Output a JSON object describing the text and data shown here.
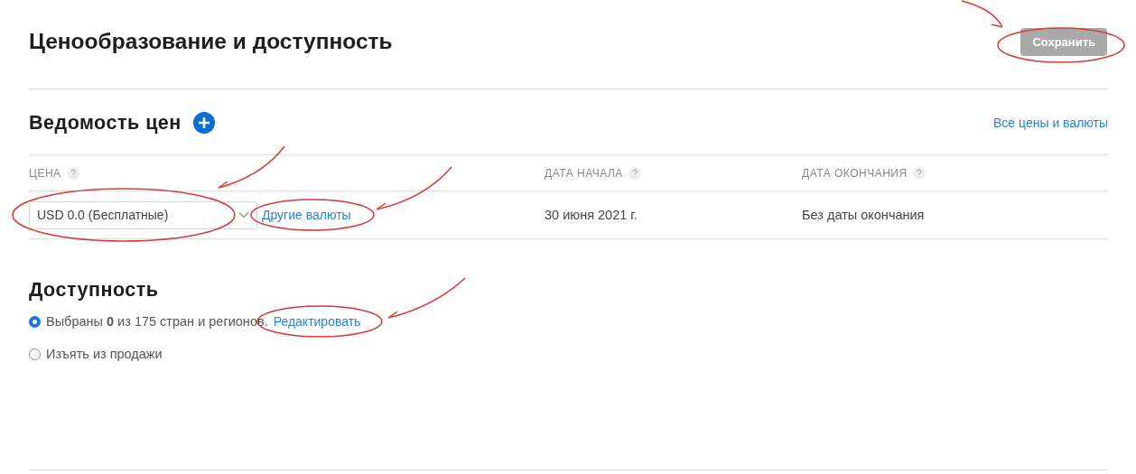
{
  "header": {
    "title": "Ценообразование и доступность",
    "save_button": {
      "label": "Сохранить",
      "disabled": true
    }
  },
  "price_schedule": {
    "title": "Ведомость цен",
    "all_prices_link": "Все цены и валюты",
    "columns": [
      {
        "label": "ЦЕНА"
      },
      {
        "label": "ДАТА НАЧАЛА"
      },
      {
        "label": "ДАТА ОКОНЧАНИЯ"
      }
    ],
    "rows": [
      {
        "price_select": {
          "value": "USD 0.0 (Бесплатные)"
        },
        "other_currencies_link": "Другие валюты",
        "start_date": "30 июня 2021 г.",
        "end_date": "Без даты окончания"
      }
    ]
  },
  "availability": {
    "title": "Доступность",
    "options": [
      {
        "label": "Выбраны **0** из 175 стран и регионов.",
        "selected": true,
        "link": "Редактировать"
      },
      {
        "label": "Изъять из продажи",
        "selected": false
      }
    ]
  }
}
